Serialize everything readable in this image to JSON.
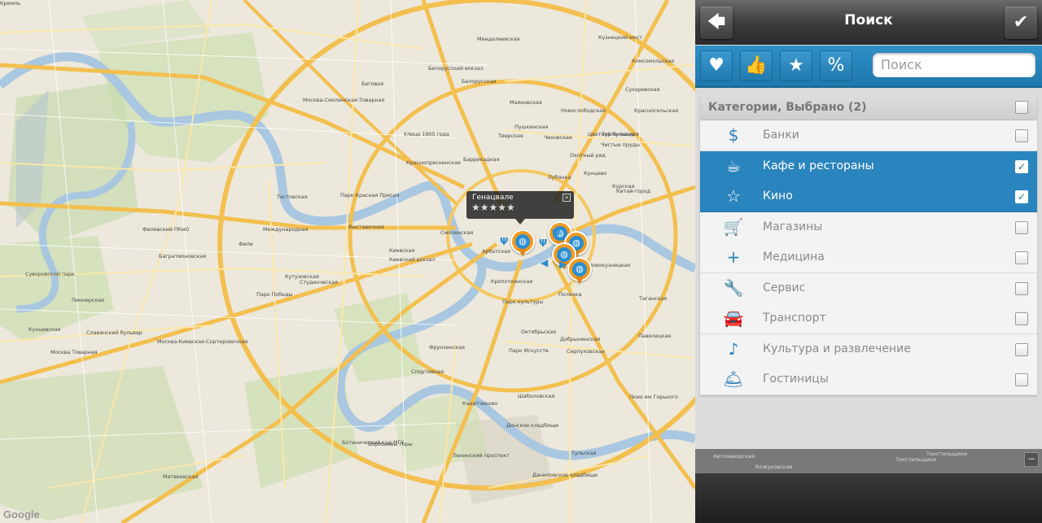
{
  "panel": {
    "title": "Поиск",
    "back_icon": "back-arrow-icon",
    "confirm_icon": "checkmark-icon",
    "filters": {
      "favorites_icon": "heart-icon",
      "likes_icon": "thumbs-up-icon",
      "rated_icon": "star-icon",
      "discount_icon": "percent-icon",
      "search_placeholder": "Поиск"
    },
    "categories_header": "Категории, Выбрано (2)",
    "categories": [
      {
        "label": "Банки",
        "icon": "dollar-icon",
        "glyph": "$",
        "selected": false
      },
      {
        "label": "Кафе и рестораны",
        "icon": "coffee-cup-icon",
        "glyph": "☕",
        "selected": true
      },
      {
        "label": "Кино",
        "icon": "star-outline-icon",
        "glyph": "☆",
        "selected": true
      },
      {
        "label": "Магазины",
        "icon": "shopping-cart-icon",
        "glyph": "🛒",
        "selected": false
      },
      {
        "label": "Медицина",
        "icon": "medical-cross-icon",
        "glyph": "+",
        "selected": false
      },
      {
        "label": "Сервис",
        "icon": "wrench-icon",
        "glyph": "🔧",
        "selected": false
      },
      {
        "label": "Транспорт",
        "icon": "car-icon",
        "glyph": "🚘",
        "selected": false
      },
      {
        "label": "Культура и развлечение",
        "icon": "culture-icon",
        "glyph": "♪",
        "selected": false
      },
      {
        "label": "Гостиницы",
        "icon": "hotel-bell-icon",
        "glyph": "🛎",
        "selected": false
      }
    ],
    "bottom_strip": [
      "Автозаводская",
      "Кожуховская",
      "Текстильщики",
      "Текстильщики"
    ]
  },
  "map": {
    "popup": {
      "name": "Генацвале",
      "rating": 5,
      "stars": "★★★★★",
      "close": "×"
    },
    "attribution": "Google",
    "labels": [
      {
        "t": "Менделеевская"
      },
      {
        "t": "Белорусский вокзал"
      },
      {
        "t": "Белорусская"
      },
      {
        "t": "Маяковская"
      },
      {
        "t": "Пушкинская"
      },
      {
        "t": "Тверская"
      },
      {
        "t": "Чеховская"
      },
      {
        "t": "Баррикадная"
      },
      {
        "t": "Краснопресненская"
      },
      {
        "t": "Улица 1905 года"
      },
      {
        "t": "Беговая"
      },
      {
        "t": "Москва-Смоленская-Товарная"
      },
      {
        "t": "Тестовская"
      },
      {
        "t": "Парк Красная Пресня"
      },
      {
        "t": "Выставочная"
      },
      {
        "t": "Международная"
      },
      {
        "t": "Филевский ПКиО"
      },
      {
        "t": "Фили"
      },
      {
        "t": "Багратионовская"
      },
      {
        "t": "Кутузовская"
      },
      {
        "t": "Киевская"
      },
      {
        "t": "Киевский вокзал"
      },
      {
        "t": "Студенческая"
      },
      {
        "t": "Смоленская"
      },
      {
        "t": "Арбатская"
      },
      {
        "t": "Кропоткинская"
      },
      {
        "t": "Парк культуры"
      },
      {
        "t": "Фрунзенская"
      },
      {
        "t": "Спортивная"
      },
      {
        "t": "Парк Победы"
      },
      {
        "t": "Пионерская"
      },
      {
        "t": "Славянский бульвар"
      },
      {
        "t": "Кунцевская"
      },
      {
        "t": "Москва-Киевская-Сортировочная"
      },
      {
        "t": "Суворовский парк"
      },
      {
        "t": "Октябрьская"
      },
      {
        "t": "Полянка"
      },
      {
        "t": "Добрынинская"
      },
      {
        "t": "Серпуховская"
      },
      {
        "t": "Шаболовская"
      },
      {
        "t": "Парк Искусств"
      },
      {
        "t": "Ленинский проспект"
      },
      {
        "t": "Тульская"
      },
      {
        "t": "Павелецкая"
      },
      {
        "t": "Таганская"
      },
      {
        "t": "Китай-город"
      },
      {
        "t": "Курская"
      },
      {
        "t": "Чистые пруды"
      },
      {
        "t": "Тургеневская"
      },
      {
        "t": "Сухаревская"
      },
      {
        "t": "Красносельская"
      },
      {
        "t": "Комсомольская"
      },
      {
        "t": "Новослободская"
      },
      {
        "t": "Цветной бульвар"
      },
      {
        "t": "Новокузнецкая"
      },
      {
        "t": "Матвеевская"
      },
      {
        "t": "Воробьевы горы"
      },
      {
        "t": "Ботанический сад МГУ"
      },
      {
        "t": "Донское кладбище"
      },
      {
        "t": "Даниловское кладбище"
      },
      {
        "t": "Канатчиково"
      },
      {
        "t": "Пкио им Горького"
      },
      {
        "t": "Москва Товарная"
      },
      {
        "t": "Кунцево"
      },
      {
        "t": "Лубянка"
      },
      {
        "t": "Охотный ряд"
      },
      {
        "t": "Кузнецкий мост"
      },
      {
        "t": "Кремль"
      }
    ]
  }
}
